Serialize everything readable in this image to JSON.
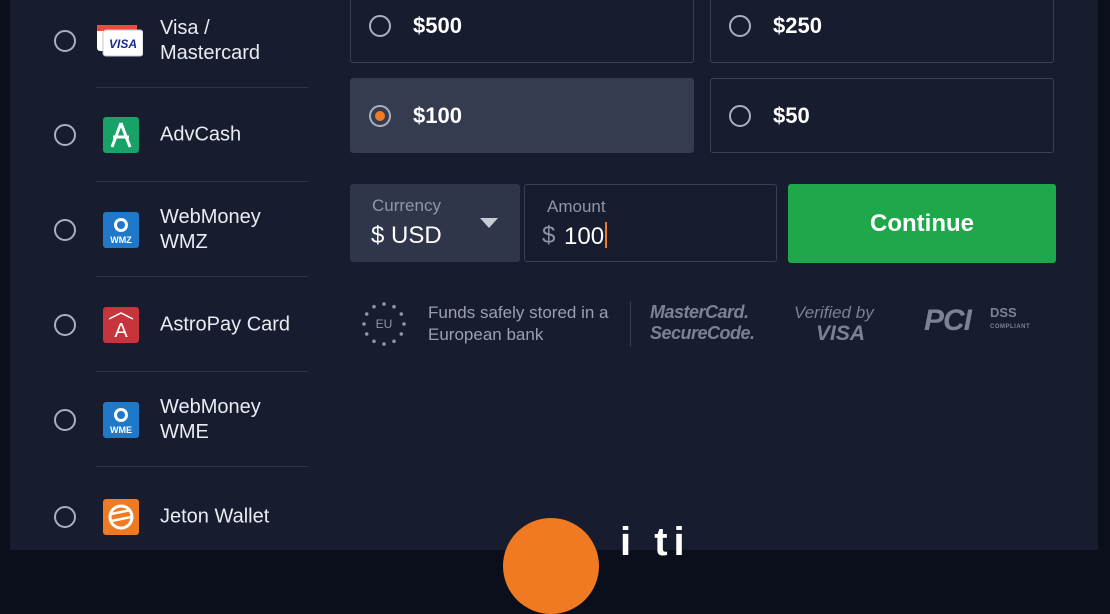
{
  "payment_methods": [
    {
      "label": "Visa / Mastercard",
      "icon": "visa-card-icon",
      "selected": false
    },
    {
      "label": "AdvCash",
      "icon": "advcash-icon",
      "selected": false
    },
    {
      "label": "WebMoney WMZ",
      "icon": "webmoney-wmz-icon",
      "selected": false
    },
    {
      "label": "AstroPay Card",
      "icon": "astropay-icon",
      "selected": false
    },
    {
      "label": "WebMoney WME",
      "icon": "webmoney-wme-icon",
      "selected": false
    },
    {
      "label": "Jeton Wallet",
      "icon": "jeton-wallet-icon",
      "selected": false
    }
  ],
  "method_logos": {
    "visa_text": "VISA",
    "wmz_text": "WMZ",
    "wme_text": "WME",
    "astropay_text": "A",
    "advcash_text": "A"
  },
  "amount_options": [
    {
      "label": "$500",
      "selected": false
    },
    {
      "label": "$250",
      "selected": false
    },
    {
      "label": "$100",
      "selected": true
    },
    {
      "label": "$50",
      "selected": false
    }
  ],
  "currency": {
    "caption": "Currency",
    "value": "$ USD"
  },
  "amount": {
    "caption": "Amount",
    "prefix": "$",
    "value": "100"
  },
  "continue_label": "Continue",
  "trust": {
    "eu_label": "EU",
    "text": "Funds safely stored in a European bank",
    "mastercard_line1": "MasterCard.",
    "mastercard_line2": "SecureCode.",
    "visa_line1": "Verified by",
    "visa_line2": "VISA",
    "pci_text": "PCI",
    "pci_dss": "DSS",
    "pci_compliant": "COMPLIANT"
  },
  "brand": {
    "partial_text": "i   ti"
  },
  "colors": {
    "background": "#171c2e",
    "accent_orange": "#f07a21",
    "continue_green": "#1ea84a",
    "selected_option": "#353c50"
  }
}
